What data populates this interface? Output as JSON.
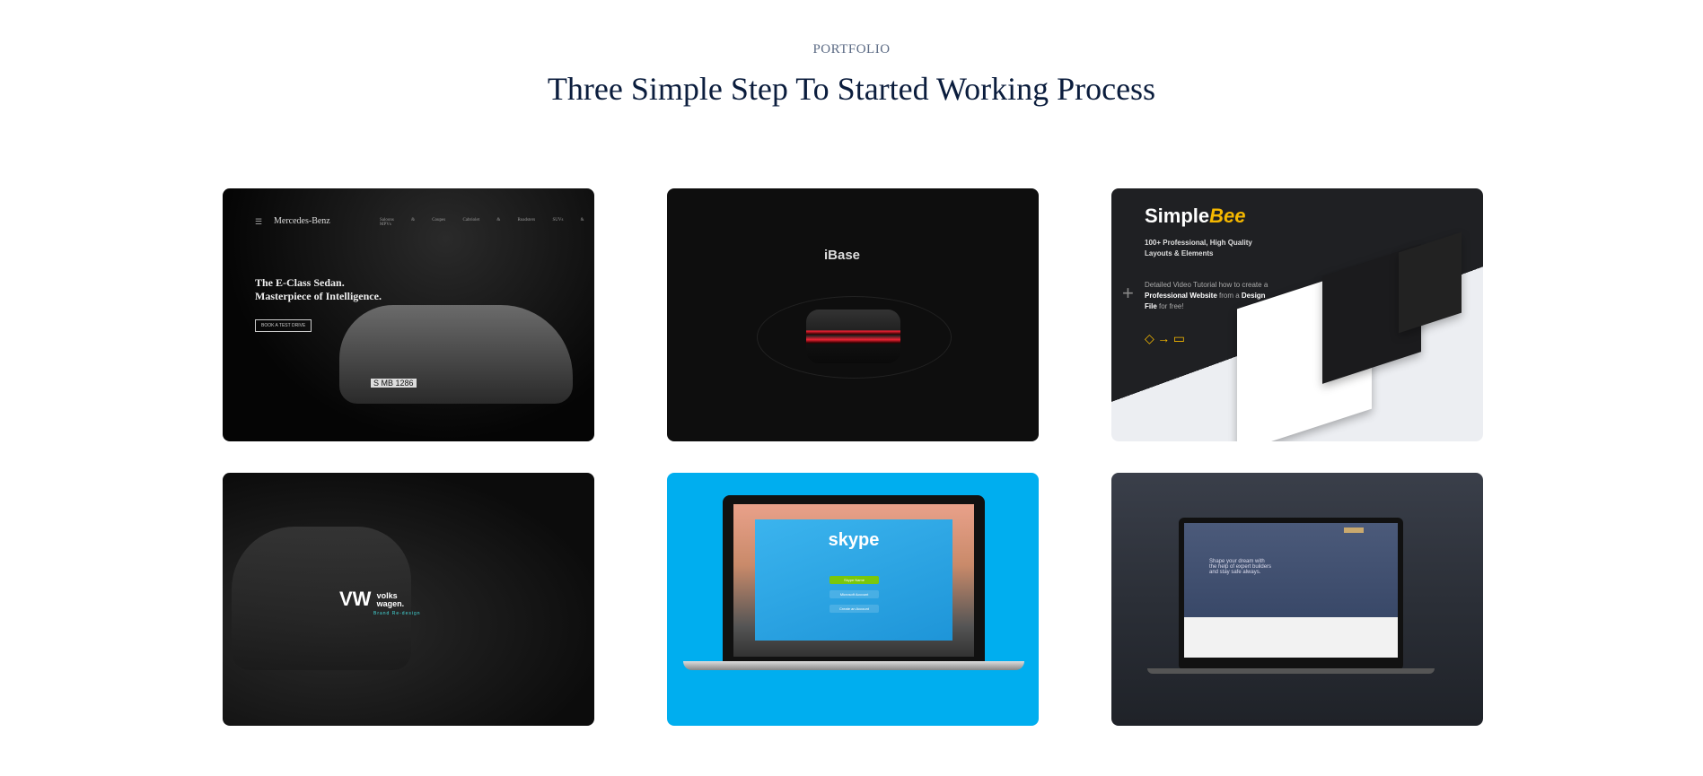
{
  "section": {
    "eyebrow": "PORTFOLIO",
    "title": "Three Simple Step To Started Working Process"
  },
  "portfolio": [
    {
      "name": "Mercedes-Benz",
      "nav": "Saloons & Coupes   Cabriolet & Roadsters   SUVs & MPVs",
      "headline1": "The E-Class Sedan.",
      "headline2": "Masterpiece of Intelligence.",
      "button": "BOOK A TEST DRIVE",
      "plate": "S MB 1286"
    },
    {
      "name": "iBase"
    },
    {
      "name_a": "Simple",
      "name_b": "Bee",
      "subtitle": "100+ Professional, High Quality Layouts & Elements",
      "tut_a": "Detailed Video Tutorial how to create a ",
      "tut_b": "Professional Website",
      "tut_c": " from a ",
      "tut_d": "Design File",
      "tut_e": " for free!"
    },
    {
      "name_a": "volks",
      "name_b": "wagen.",
      "tagline": "Brand Re-design"
    },
    {
      "name": "skype",
      "btn1": "Skype Name",
      "btn2": "Microsoft Account",
      "btn3": "Create an Account"
    },
    {
      "headline": "Shape your dream with the help of expert builders and stay safe always."
    }
  ],
  "colors": {
    "title": "#0b1d3d",
    "eyebrow": "#5b6a84",
    "skype_bg": "#00aeef",
    "bee_yellow": "#f5b800"
  }
}
